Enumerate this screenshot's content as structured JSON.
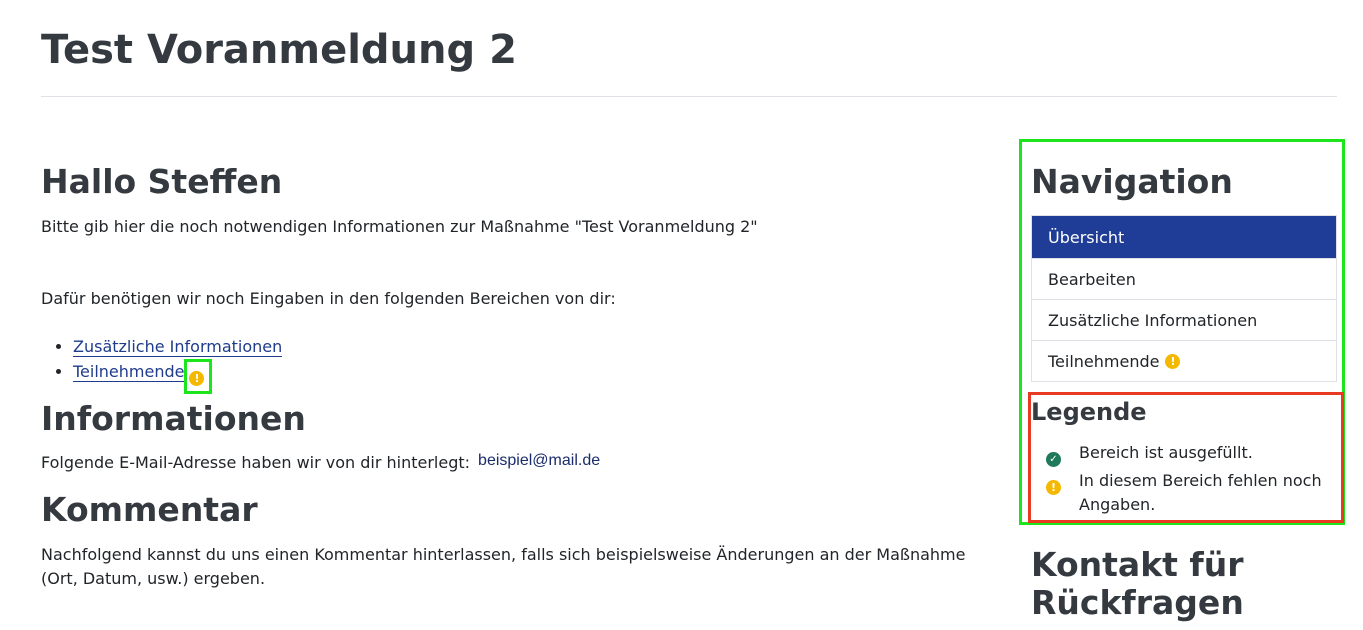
{
  "page": {
    "title": "Test Voranmeldung 2"
  },
  "greeting": {
    "heading": "Hallo Steffen",
    "intro": "Bitte gib hier die noch notwendigen Informationen zur Maßnahme \"Test Voranmeldung 2\"",
    "required_text": "Dafür benötigen wir noch Eingaben in den folgenden Bereichen von dir:",
    "required_links": [
      {
        "label": "Zusätzliche Informationen",
        "warning": false
      },
      {
        "label": "Teilnehmende",
        "warning": true
      }
    ],
    "warning_glyph": "!"
  },
  "informationen": {
    "heading": "Informationen",
    "email_text": "Folgende E-Mail-Adresse haben wir von dir hinterlegt:",
    "email": "beispiel@mail.de"
  },
  "kommentar": {
    "heading": "Kommentar",
    "text": "Nachfolgend kannst du uns einen Kommentar hinterlassen, falls sich beispielsweise Änderungen an der Maßnahme (Ort, Datum, usw.) ergeben."
  },
  "navigation": {
    "heading": "Navigation",
    "items": [
      {
        "label": "Übersicht",
        "active": true
      },
      {
        "label": "Bearbeiten",
        "active": false
      },
      {
        "label": "Zusätzliche Informationen",
        "active": false
      },
      {
        "label": "Teilnehmende",
        "active": false,
        "warning": true
      }
    ]
  },
  "legend": {
    "heading": "Legende",
    "items": [
      {
        "icon": "check-circle-icon",
        "glyph": "✓",
        "text": "Bereich ist ausgefüllt."
      },
      {
        "icon": "warning-circle-icon",
        "glyph": "!",
        "text": "In diesem Bereich fehlen noch Angaben."
      }
    ]
  },
  "contact": {
    "heading": "Kontakt für Rückfragen"
  },
  "colors": {
    "primary": "#1f3d96",
    "link": "#1f3b8c",
    "warning": "#f5b800",
    "success": "#1e7a5a",
    "highlight_green": "#1ce51c",
    "highlight_red": "#e83a22"
  }
}
